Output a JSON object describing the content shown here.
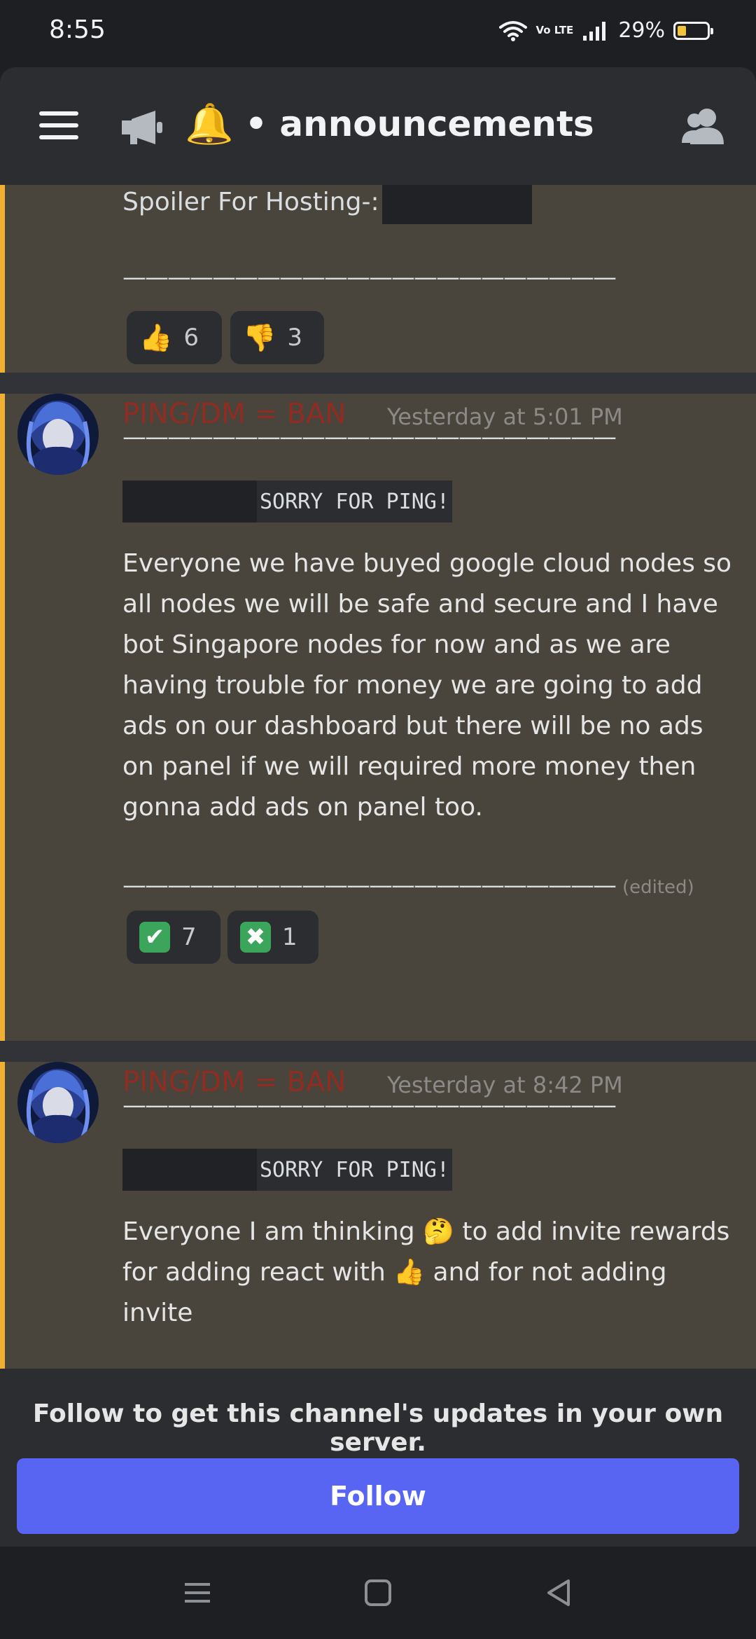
{
  "status_bar": {
    "time": "8:55",
    "network": "Vo LTE",
    "battery": "29%",
    "battery_level": 0.29
  },
  "header": {
    "channel_name": "announcements",
    "channel_prefix_icons": [
      "megaphone-icon",
      "bell-emoji"
    ],
    "icons": {
      "menu": "hamburger-icon",
      "members": "members-icon"
    }
  },
  "messages": [
    {
      "spoiler_label": "Spoiler For Hosting-:",
      "divider": "——————————————————————",
      "reactions": [
        {
          "emoji": "👍",
          "count": "6"
        },
        {
          "emoji": "👎",
          "count": "3"
        }
      ]
    },
    {
      "author": "PING/DM = BAN",
      "timestamp": "Yesterday at 5:01 PM",
      "divider": "——————————————————————",
      "code": "SORRY FOR PING!",
      "body": "Everyone we have buyed google cloud nodes so all nodes we will be safe and secure and I have bot Singapore nodes for now and as we are having trouble for money we are going to add ads on our dashboard but there will be no ads on panel if we will required more money then gonna add ads on panel too.",
      "divider_end": "——————————————————————",
      "edited": "(edited)",
      "reactions": [
        {
          "emoji": "✔",
          "count": "7"
        },
        {
          "emoji": "✖",
          "count": "1"
        }
      ]
    },
    {
      "author": "PING/DM = BAN",
      "timestamp": "Yesterday at 8:42 PM",
      "divider": "——————————————————————",
      "code": "SORRY FOR PING!",
      "body_parts": [
        "Everyone I am thinking",
        "🤔",
        "to add invite rewards for adding react with",
        "👍",
        "and for not adding invite"
      ]
    }
  ],
  "follow": {
    "text": "Follow to get this channel's updates in your own server.",
    "button": "Follow"
  },
  "colors": {
    "accent": "#5865f2",
    "highlight_bar": "#f0b132",
    "author": "#8f2d23"
  }
}
